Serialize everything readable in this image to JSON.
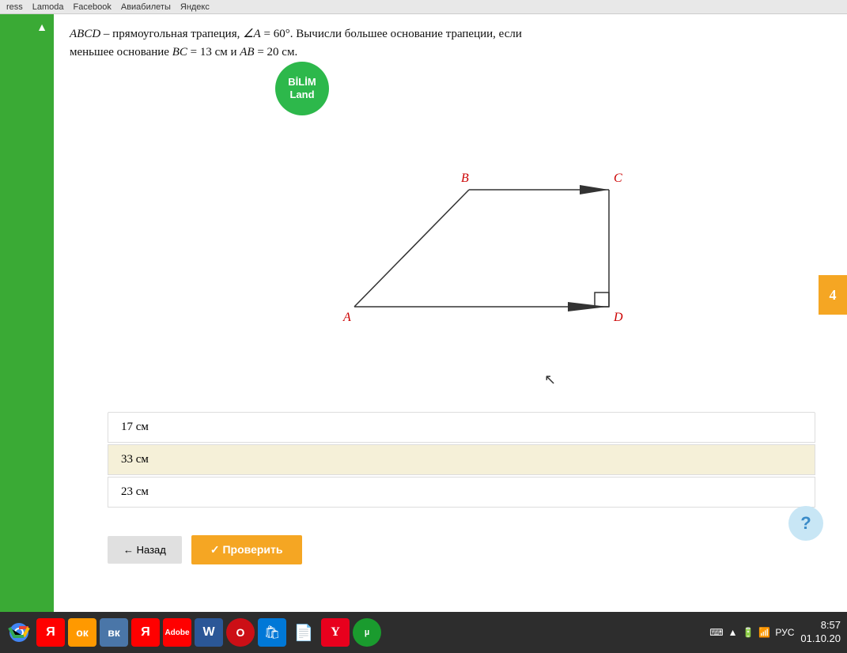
{
  "browser": {
    "links": [
      "ress",
      "Lamoda",
      "Facebook",
      "Авиабилеты",
      "Яндекс"
    ]
  },
  "bilim": {
    "line1": "BİLİM",
    "line2": "Land"
  },
  "problem": {
    "text1": "ABCD",
    "text2": " – прямоугольная трапеция, ",
    "angle": "∠A = 60°",
    "text3": ". Вычисли большее основание трапеции, если",
    "text4": "меньшее основание ",
    "bc": "BC",
    "eq1": " = 13 см и ",
    "ab": "AB",
    "eq2": " = 20 см."
  },
  "answers": [
    {
      "label": "17 см"
    },
    {
      "label": "33 см",
      "selected": true
    },
    {
      "label": "23 см"
    }
  ],
  "buttons": {
    "back_label": "← Назад",
    "check_label": "✓ Проверить"
  },
  "right_btn": {
    "label": "4"
  },
  "help_btn": {
    "label": "?"
  },
  "diagram": {
    "vertices": {
      "A": "A",
      "B": "B",
      "C": "C",
      "D": "D"
    }
  },
  "taskbar": {
    "time": "8:57",
    "date": "01.10.20",
    "lang": "РУС"
  }
}
